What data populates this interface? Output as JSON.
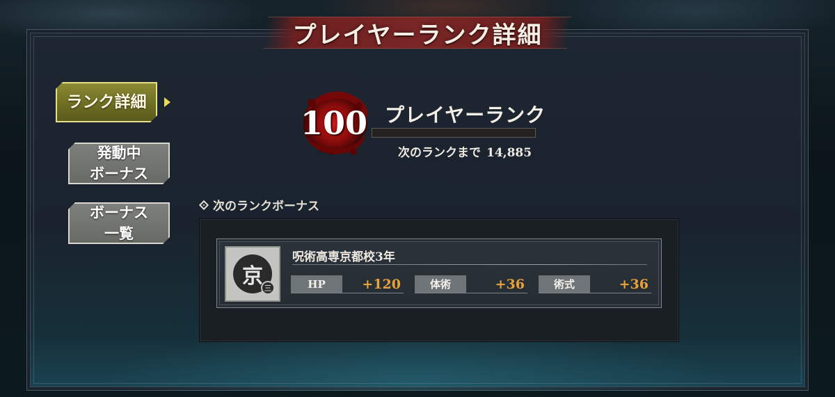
{
  "title": "プレイヤーランク詳細",
  "sidebar": {
    "items": [
      {
        "label": "ランク詳細",
        "active": true
      },
      {
        "label_line1": "発動中",
        "label_line2": "ボーナス",
        "active": false
      },
      {
        "label_line1": "ボーナス",
        "label_line2": "一覧",
        "active": false
      }
    ]
  },
  "rank": {
    "value": "100",
    "label": "プレイヤーランク",
    "progress": 0.0,
    "next_label": "次のランクまで",
    "next_value": "14,885"
  },
  "next_bonus": {
    "section_title": "次のランクボーナス",
    "icon": "kyoto-school-emblem-icon",
    "icon_glyph": "京",
    "name": "呪術高専京都校3年",
    "stats": [
      {
        "label": "HP",
        "value": "+120"
      },
      {
        "label": "体術",
        "value": "+36"
      },
      {
        "label": "術式",
        "value": "+36"
      }
    ]
  },
  "colors": {
    "title_banner": "#7a2626",
    "active_tab": "#8b8a33",
    "inactive_tab": "#7e807c",
    "stat_value": "#e8a23c",
    "rank_emblem": "#c01818"
  }
}
